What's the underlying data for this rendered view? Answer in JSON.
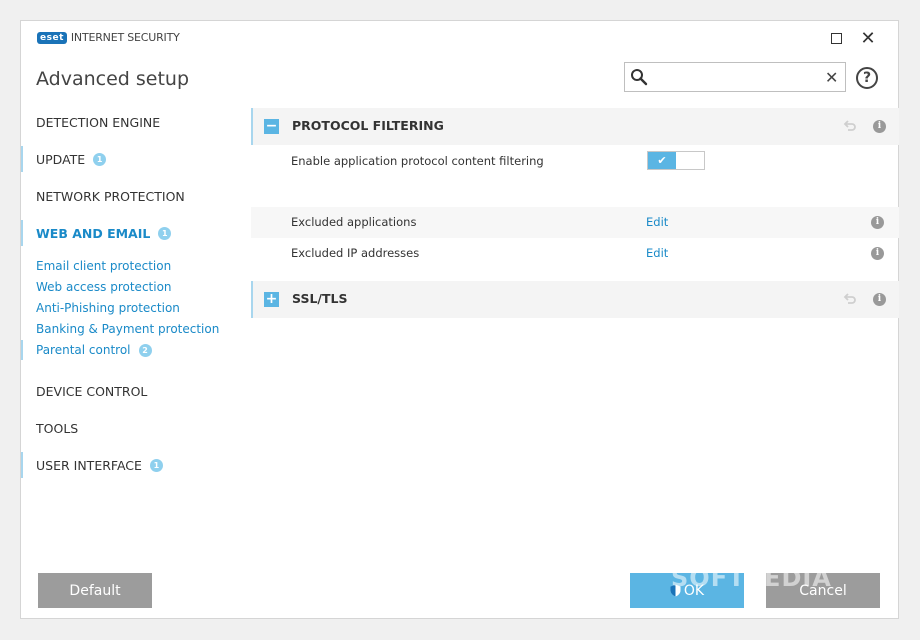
{
  "window": {
    "brand_badge": "eset",
    "brand_text": "INTERNET SECURITY",
    "close_glyph": "✕"
  },
  "header": {
    "title": "Advanced setup",
    "search_value": "",
    "search_placeholder": "",
    "clear_glyph": "✕",
    "help_glyph": "?"
  },
  "sidebar": {
    "items": [
      {
        "label": "DETECTION ENGINE",
        "badge": ""
      },
      {
        "label": "UPDATE",
        "badge": "1"
      },
      {
        "label": "NETWORK PROTECTION",
        "badge": ""
      },
      {
        "label": "WEB AND EMAIL",
        "badge": "1"
      },
      {
        "label": "DEVICE CONTROL",
        "badge": ""
      },
      {
        "label": "TOOLS",
        "badge": ""
      },
      {
        "label": "USER INTERFACE",
        "badge": "1"
      }
    ],
    "subitems": [
      {
        "label": "Email client protection",
        "badge": ""
      },
      {
        "label": "Web access protection",
        "badge": ""
      },
      {
        "label": "Anti-Phishing protection",
        "badge": ""
      },
      {
        "label": "Banking & Payment protection",
        "badge": ""
      },
      {
        "label": "Parental control",
        "badge": "2"
      }
    ]
  },
  "content": {
    "protocol_section": {
      "title": "PROTOCOL FILTERING",
      "toggle_glyph": "−",
      "info_glyph": "i",
      "rows": [
        {
          "label": "Enable application protocol content filtering",
          "enabled": true,
          "check_glyph": "✔"
        },
        {
          "label": "Excluded applications",
          "action": "Edit",
          "info_glyph": "i"
        },
        {
          "label": "Excluded IP addresses",
          "action": "Edit",
          "info_glyph": "i"
        }
      ]
    },
    "ssl_section": {
      "title": "SSL/TLS",
      "toggle_glyph": "+",
      "info_glyph": "i"
    }
  },
  "footer": {
    "default_label": "Default",
    "ok_label": "OK",
    "cancel_label": "Cancel",
    "watermark": "SOFTPEDIA"
  },
  "colors": {
    "accent": "#1a8ac8",
    "accent_light": "#5bb5e3",
    "button_gray": "#9c9c9c",
    "marker": "#a8d6ee"
  }
}
